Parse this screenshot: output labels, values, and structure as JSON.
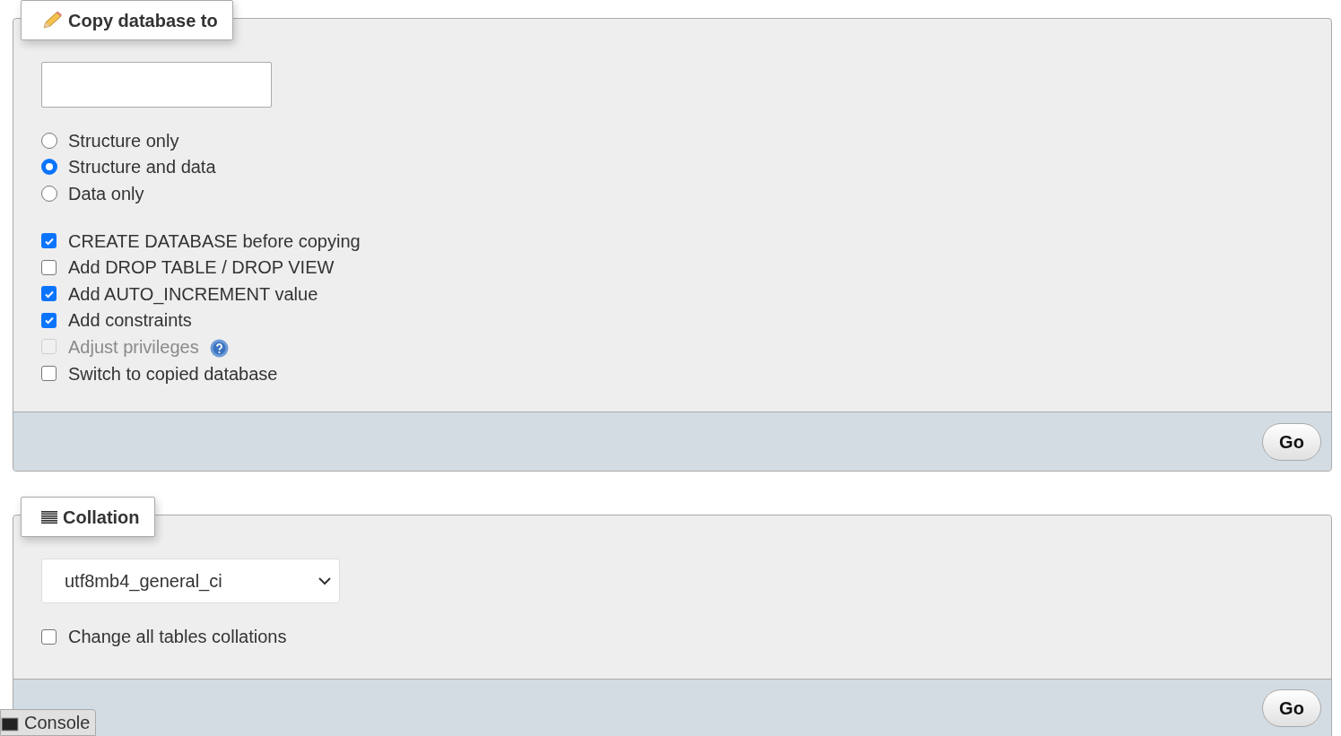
{
  "copy_panel": {
    "legend": "Copy database to",
    "modes": [
      {
        "label": "Structure only",
        "selected": false
      },
      {
        "label": "Structure and data",
        "selected": true
      },
      {
        "label": "Data only",
        "selected": false
      }
    ],
    "options": [
      {
        "label": "CREATE DATABASE before copying",
        "checked": true,
        "disabled": false,
        "help": false
      },
      {
        "label": "Add DROP TABLE / DROP VIEW",
        "checked": false,
        "disabled": false,
        "help": false
      },
      {
        "label": "Add AUTO_INCREMENT value",
        "checked": true,
        "disabled": false,
        "help": false
      },
      {
        "label": "Add constraints",
        "checked": true,
        "disabled": false,
        "help": false
      },
      {
        "label": "Adjust privileges",
        "checked": false,
        "disabled": true,
        "help": true
      },
      {
        "label": "Switch to copied database",
        "checked": false,
        "disabled": false,
        "help": false
      }
    ],
    "go_button": "Go"
  },
  "collation_panel": {
    "legend": "Collation",
    "select_value": "utf8mb4_general_ci",
    "options": [
      {
        "label": "Change all tables collations",
        "checked": false,
        "disabled": false,
        "help": false
      }
    ],
    "go_button": "Go"
  },
  "console_tab": "Console"
}
